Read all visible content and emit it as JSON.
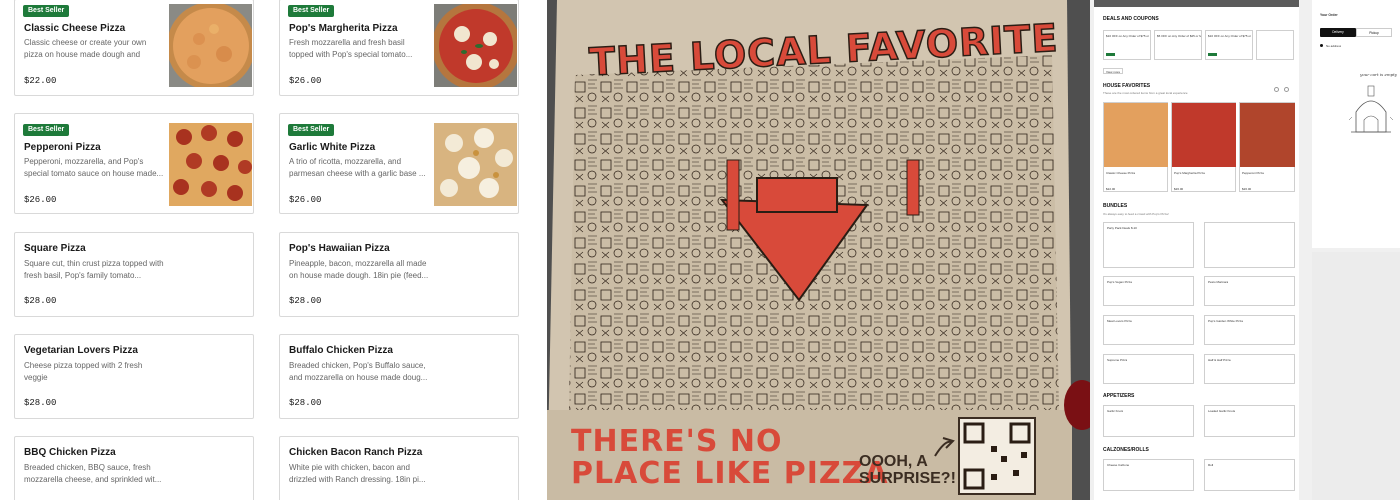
{
  "menu": {
    "items": [
      {
        "name": "Classic Cheese Pizza",
        "desc": "Classic cheese or create your own pizza on house made dough and Pop's...",
        "price": "$22.00",
        "badge": "Best Seller"
      },
      {
        "name": "Pop's Margherita Pizza",
        "desc": "Fresh mozzarella and fresh basil topped with Pop's special tomato...",
        "price": "$26.00",
        "badge": "Best Seller"
      },
      {
        "name": "Pepperoni Pizza",
        "desc": "Pepperoni, mozzarella, and Pop's special tomato sauce on house made...",
        "price": "$26.00",
        "badge": "Best Seller"
      },
      {
        "name": "Garlic White Pizza",
        "desc": "A trio of ricotta, mozzarella, and parmesan cheese with a garlic base ...",
        "price": "$26.00",
        "badge": "Best Seller"
      },
      {
        "name": "Square Pizza",
        "desc": "Square cut, thin crust pizza topped with fresh basil, Pop's family tomato...",
        "price": "$28.00",
        "badge": ""
      },
      {
        "name": "Pop's Hawaiian Pizza",
        "desc": "Pineapple, bacon, mozzarella all made on house made dough. 18in pie (feed...",
        "price": "$28.00",
        "badge": ""
      },
      {
        "name": "Vegetarian Lovers Pizza",
        "desc": "Cheese pizza topped with 2 fresh veggie",
        "price": "$28.00",
        "badge": ""
      },
      {
        "name": "Buffalo Chicken Pizza",
        "desc": "Breaded chicken, Pop's Buffalo sauce, and mozzarella on house made doug...",
        "price": "$28.00",
        "badge": ""
      },
      {
        "name": "BBQ Chicken Pizza",
        "desc": "Breaded chicken, BBQ sauce, fresh mozzarella cheese, and sprinkled wit...",
        "price": "",
        "badge": ""
      },
      {
        "name": "Chicken Bacon Ranch Pizza",
        "desc": "White pie with chicken, bacon and drizzled with Ranch dressing. 18in pi...",
        "price": "",
        "badge": ""
      }
    ]
  },
  "box": {
    "headline_top": "THE LOCAL FAVORITE",
    "headline_bottom_1": "THERE'S NO",
    "headline_bottom_2": "PLACE LIKE PIZZA",
    "surprise_1": "OOOH, A",
    "surprise_2": "SURPRISE?!",
    "colors": {
      "cardboard": "#cfc2ad",
      "red": "#d84a3a",
      "ink": "#2a1d14"
    }
  },
  "site": {
    "deals_title": "DEALS AND COUPONS",
    "deal_1": "$10 OFF on Any Order of $75 or More",
    "deal_2": "$5 OFF on Any Order of $25 or More",
    "deal_3": "$10 OFF on Any Order of $75 or More",
    "view_more": "View more",
    "favorites_title": "HOUSE FAVORITES",
    "favorites_sub": "These are the most ordered items from a great local experience",
    "fav_1": "Classic Cheese Pizza",
    "fav_2": "Pop's Margherita Pizza",
    "fav_3": "Pepperoni Pizza",
    "fav_price_1": "$22.00",
    "fav_price_2": "$26.00",
    "fav_price_3": "$26.00",
    "bundles_title": "BUNDLES",
    "bundles_sub": "It's always easy to feed a crowd with Pop's Pizza!",
    "bundle_1": "Party Pack Deals 8-10",
    "bundle_2": "Pop's Vegan Pizza",
    "bundle_3": "Pesto Marinara",
    "bundle_4": "Meat Lovers Pizza",
    "bundle_5": "Pop's Garden White Pizza",
    "bundle_6": "Supreme Pizza",
    "bundle_7": "Half & Half Pizza",
    "appetizers_title": "APPETIZERS",
    "app_1": "Garlic Knots",
    "app_2": "Loaded Garlic Knots",
    "calzones_title": "CALZONES/ROLLS",
    "cal_1": "Cheese Calzone",
    "cal_2": "Roll",
    "order_title": "Your Order",
    "tab_delivery": "Delivery",
    "tab_pickup": "Pickup",
    "no_address": "No address",
    "cart_empty": "your cart is empty"
  }
}
